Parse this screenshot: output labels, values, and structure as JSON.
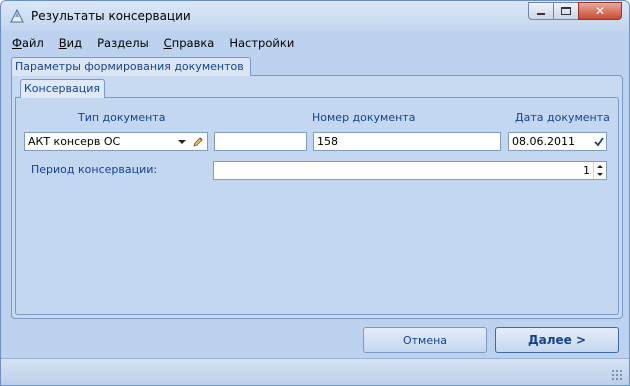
{
  "window": {
    "title": "Результаты консервации",
    "controls": [
      "minimize-icon",
      "maximize-icon",
      "close-icon"
    ]
  },
  "menu": {
    "items": [
      {
        "label_ul": "Ф",
        "label_rest": "айл"
      },
      {
        "label_ul": "В",
        "label_rest": "ид"
      },
      {
        "label_ul": "",
        "label_rest": "Разделы"
      },
      {
        "label_ul": "С",
        "label_rest": "правка"
      },
      {
        "label_ul": "",
        "label_rest": "Настройки"
      }
    ]
  },
  "tabs": {
    "outer": "Параметры формирования документов",
    "inner": "Консервация"
  },
  "form": {
    "doc_type_label": "Тип документа",
    "doc_type_value": "АКТ консерв ОС",
    "doc_extra_value": "",
    "doc_number_label": "Номер документа",
    "doc_number_value": "158",
    "doc_date_label": "Дата документа",
    "doc_date_value": "08.06.2011",
    "period_label": "Период консервации:",
    "period_value": "1"
  },
  "buttons": {
    "cancel": "Отмена",
    "next": "Далее >"
  },
  "colors": {
    "background": "#bcd2ee",
    "label_text": "#15428b",
    "close_button": "#c74a31"
  }
}
